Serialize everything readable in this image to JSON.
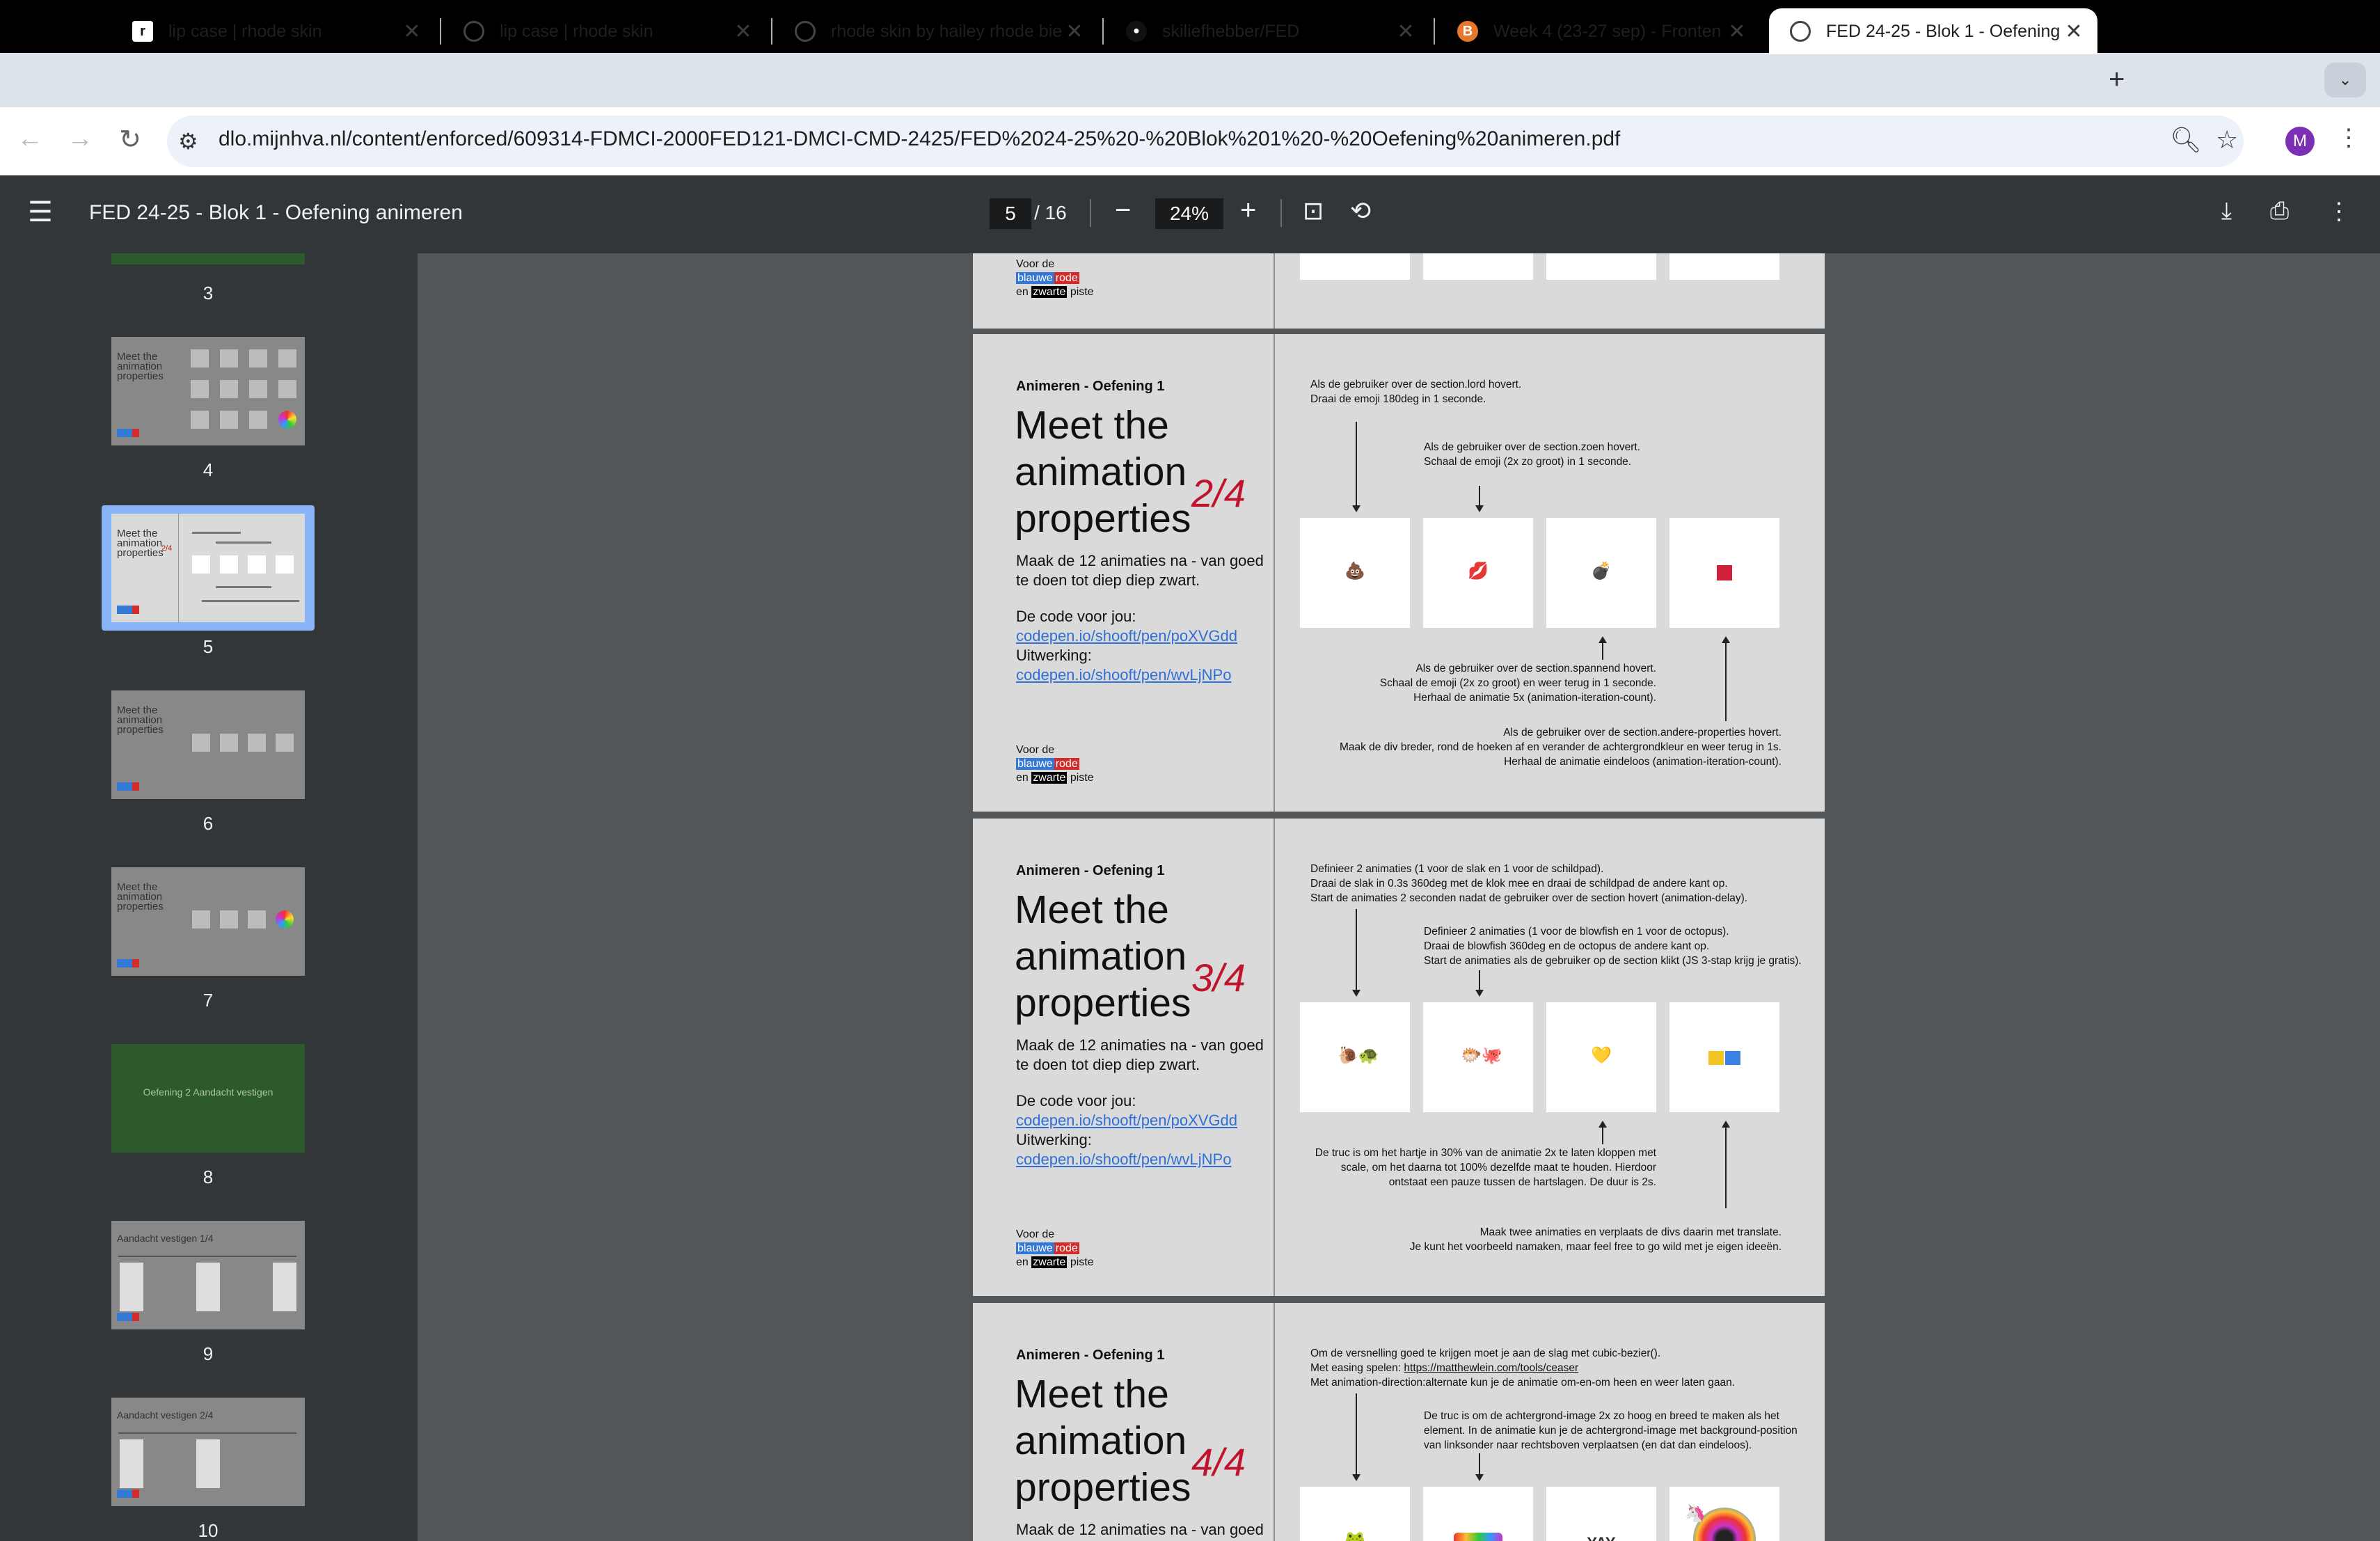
{
  "browser": {
    "tabs": [
      {
        "title": "lip case | rhode skin",
        "icon": "r-favicon-icon"
      },
      {
        "title": "lip case | rhode skin",
        "icon": "globe-icon"
      },
      {
        "title": "rhode skin by hailey rhode bie",
        "icon": "globe-icon"
      },
      {
        "title": "skiliefhebber/FED",
        "icon": "github-icon"
      },
      {
        "title": "Week 4 (23-27 sep) - Fronten",
        "icon": "brightspace-icon"
      },
      {
        "title": "FED 24-25 - Blok 1 - Oefening",
        "icon": "globe-icon"
      }
    ],
    "url": "dlo.mijnhva.nl/content/enforced/609314-FDMCI-2000FED121-DMCI-CMD-2425/FED%2024-25%20-%20Blok%201%20-%20Oefening%20animeren.pdf",
    "profile_initial": "M",
    "accent": "#7b2fb5"
  },
  "viewer": {
    "title": "FED 24-25 - Blok 1 - Oefening animeren",
    "current_page": "5",
    "total_pages": "/ 16",
    "zoom": "24%"
  },
  "thumbnails": {
    "labels": [
      "3",
      "4",
      "5",
      "6",
      "7",
      "8",
      "9",
      "10"
    ],
    "page8_text": "Oefening 2 Aandacht vestigen",
    "page9_title": "Aandacht vestigen 1/4",
    "page10_title": "Aandacht vestigen 2/4"
  },
  "pages": {
    "common": {
      "kicker": "Animeren - Oefening 1",
      "title_line1": "Meet the",
      "title_line2": "animation",
      "title_line3": "properties",
      "desc_line1": "Maak de 12 animaties na - van goed",
      "desc_line2": "te doen tot diep diep zwart.",
      "code_label": "De code voor jou:",
      "code_link": "codepen.io/shooft/pen/poXVGdd",
      "result_label": "Uitwerking:",
      "result_link": "codepen.io/shooft/pen/wvLjNPo",
      "brand_voor": "Voor de",
      "brand_blauwe": "blauwe",
      "brand_rode": "rode",
      "brand_en": "en",
      "brand_zwarte": "zwarte",
      "brand_piste": "piste"
    },
    "p2": {
      "fraction": "2/4",
      "n1a": "Als de gebruiker over de section.lord hovert.",
      "n1b": "Draai de emoji 180deg in 1 seconde.",
      "n2a": "Als de gebruiker over de section.zoen hovert.",
      "n2b": "Schaal de emoji (2x zo groot) in 1 seconde.",
      "n3a": "Als de gebruiker over de section.spannend hovert.",
      "n3b": "Schaal de emoji (2x zo groot) en weer terug in  1 seconde.",
      "n3c": "Herhaal de animatie 5x (animation-iteration-count).",
      "n4a": "Als de gebruiker over de section.andere-properties hovert.",
      "n4b": "Maak de div breder,  rond de hoeken af en verander de achtergrondkleur en weer terug in 1s.",
      "n4c": "Herhaal de animatie eindeloos (animation-iteration-count).",
      "emoji": [
        "💩",
        "💋",
        "💣",
        ""
      ]
    },
    "p3": {
      "fraction": "3/4",
      "n1a": "Definieer 2 animaties (1 voor de slak en 1 voor de schildpad).",
      "n1b": "Draai de slak in 0.3s 360deg met de klok mee en draai de schildpad de andere kant op.",
      "n1c": "Start de animaties 2 seconden nadat de gebruiker over de section hovert (animation-delay).",
      "n2a": "Definieer 2 animaties (1 voor de blowfish en 1 voor de octopus).",
      "n2b": "Draai de blowfish 360deg en de octopus de andere kant op.",
      "n2c": "Start de animaties als de gebruiker op de section klikt (JS 3-stap krijg je gratis).",
      "n3a": "De truc is om het hartje in 30% van de animatie 2x te laten kloppen met",
      "n3b": "scale, om het daarna tot 100% dezelfde maat te houden. Hierdoor",
      "n3c": "ontstaat een pauze tussen de hartslagen. De duur is 2s.",
      "n4a": "Maak twee animaties en verplaats de divs daarin met translate.",
      "n4b": "Je kunt het voorbeeld namaken, maar feel free to go wild met je eigen ideeën.",
      "emoji": [
        "🐌🐢",
        "🐡🐙",
        "💛",
        ""
      ]
    },
    "p4": {
      "fraction": "4/4",
      "n1a": "Om de versnelling goed te krijgen moet je aan de slag met cubic-bezier().",
      "n1b_pre": "Met easing spelen: ",
      "n1b_link": "https://matthewlein.com/tools/ceaser",
      "n1c": "Met animation-direction:alternate kun je de animatie om-en-om heen en weer laten gaan.",
      "n2a": "De truc is om de achtergrond-image 2x zo hoog en breed te maken als het",
      "n2b": "element. In de animatie kun je de achtergrond-image met background-position",
      "n2c": "van linksonder naar rechtsboven verplaatsen (en dat dan eindeloos).",
      "box3_text": "YAY",
      "emoji": [
        "🐸",
        "",
        "",
        "🦄"
      ]
    }
  }
}
